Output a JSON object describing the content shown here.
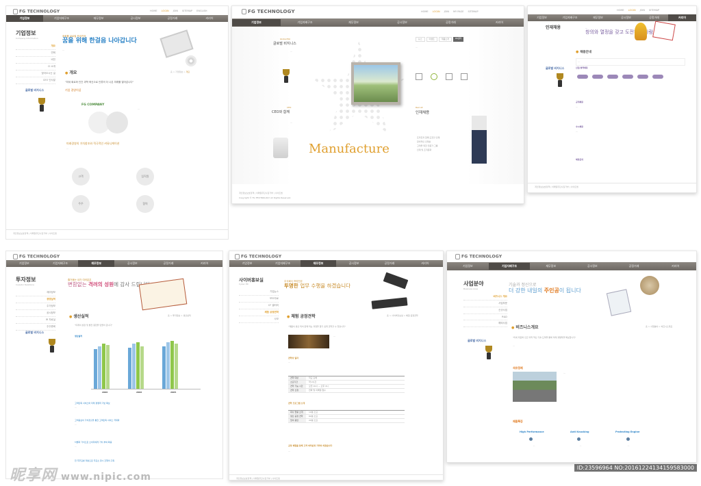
{
  "panels": {
    "p1": {
      "logo": "FG TECHNOLOGY",
      "nav": [
        "기업정보",
        "기업지배구조",
        "재무정보",
        "공시정보",
        "공정거래",
        "커리어"
      ],
      "side_title": "기업정보",
      "side_items": [
        "개요",
        "연혁",
        "비전",
        "CI 소개",
        "찾아오시는 길",
        "CEO 인사말"
      ],
      "hero_small": "조화를 글로벌 프리진의",
      "hero_main": "꿈을 위해 한걸음 나아갑니다",
      "section": "개요",
      "quote": "\"미세 회로와 인간 과학 혁신으로 인류의 더 나은 미래를 열어갑니다\"",
      "highlight": "기업 경영이념",
      "company": "FG COMPANY",
      "circles": [
        "고객",
        "임직원",
        "주주",
        "협력"
      ],
      "section2": "미래경영의 가치창조와 적극적인 커뮤니케이션",
      "badge": "글로벌 비지니스",
      "footer": "개인정보보호정책 | 이메일무단수집거부 | 사이트맵"
    },
    "p2": {
      "logo": "FG TECHNOLOGY",
      "nav": [
        "기업정보",
        "기업지배구조",
        "재무정보",
        "공시정보",
        "공정거래",
        "커리어"
      ],
      "tabs": [
        "뉴스",
        "이벤트",
        "제품소개",
        "PR센터"
      ],
      "side1": "Global Biz",
      "side1_title": "글로벌 비지니스",
      "side2": "CEO",
      "side2_title": "CEO와 함께",
      "brand": "Manufacture",
      "right_title": "인재채용",
      "right_list": [
        "프리진과 함께 도전할 인재",
        "창의적인 인재상",
        "고객을 위한 전문가 그룹",
        "인재 및 조직문화"
      ],
      "footer": "개인정보보호정책 | 이메일무단수집거부 | 사이트맵",
      "copyright": "Copyright © FG TECHNOLOGY All Rights Reserved."
    },
    "p3": {
      "logo": "FG TECHNOLOGY",
      "nav": [
        "기업정보",
        "기업지배구조",
        "재무정보",
        "공시정보",
        "공정거래",
        "커리어"
      ],
      "side_title": "인재채용",
      "hero_main": "창의와 열정을 갖고 도전하는 사람",
      "section": "채용안내",
      "sub1": "신입/경력채용",
      "sub2": "공개채용",
      "sub3": "수시채용",
      "sub4": "채용문의",
      "badge": "글로벌 비지니스",
      "footer": "개인정보보호정책 | 이메일무단수집거부 | 사이트맵"
    },
    "p4": {
      "logo": "FG TECHNOLOGY",
      "nav": [
        "기업정보",
        "기업지배구조",
        "재무정보",
        "공시정보",
        "공정거래",
        "커리어"
      ],
      "side_title": "투자정보",
      "side_items": [
        "재무정보",
        "경영실적",
        "주가정보",
        "공시정보",
        "IR 자료실",
        "주주총회"
      ],
      "hero_small": "즐거움는 내가 여러분은",
      "hero_main1": "변함없는 ",
      "hero_accent": "격려의 성원",
      "hero_main2": "에 감사 드립니다",
      "section": "생산실적",
      "quote": "\"미래의 성장 및 발전 원천을 만들어 갑니다\"",
      "chart_title": "생산실적",
      "years": [
        "2006",
        "2006",
        "2005"
      ],
      "points": [
        "고객만족 서비스와 미래 경쟁력 기반 확보",
        "고객중심의 가치창출을 통한 고객만족 서비스 극대화",
        "차별화 가치으로 소비자에게 가치 부여 확충",
        "전 주주요를 대상으로 주요소 정시 간행의 구축"
      ],
      "badge": "글로벌 비지니스"
    },
    "p5": {
      "logo": "FG TECHNOLOGY",
      "nav": [
        "기업정보",
        "기업지배구조",
        "재무정보",
        "공시정보",
        "공정거래",
        "커리어"
      ],
      "side_title": "사이버홍보실",
      "side_items": [
        "기업뉴스",
        "보도자료",
        "CF 갤러리",
        "체험 공정견학",
        "사보"
      ],
      "hero_small": "주식회사 프리진은",
      "hero_main1": "투명한 ",
      "hero_main2": "업무 수행을 하겠습니다",
      "section": "체험 공정견학",
      "quote": "\"제품이 생산 되어 판매 되는 과정을 알기 쉽게 견학할 수 있습니다\"",
      "sub1": "견학의 일자",
      "rows": [
        [
          "견학 대상",
          "학교 단체"
        ],
        [
          "소요기간",
          "약 2시간"
        ],
        [
          "견학 가능 시간",
          "오전 10시 ~ 오후 4시"
        ],
        [
          "견학 신청",
          "전화 및 이메일 접수"
        ]
      ],
      "sub2": "견학 프로그램 소개",
      "rows2": [
        [
          "회사 현황 소개",
          "10분 소요"
        ],
        [
          "생산 공정 견학",
          "60분 소요"
        ],
        [
          "질의 응답",
          "20분 소요"
        ]
      ],
      "sub3": "공정 체험을 통해 고객 여러분과 가까이 하겠습니다",
      "footer": "개인정보보호정책 | 이메일무단수집거부 | 사이트맵"
    },
    "p6": {
      "logo": "FG TECHNOLOGY",
      "nav": [
        "기업정보",
        "기업지배구조",
        "재무정보",
        "공시정보",
        "공정거래",
        "커리어"
      ],
      "side_title": "사업분야",
      "side_items": [
        "비즈니스 개요",
        "사업부문",
        "신규사업",
        "R&D",
        "해외사업"
      ],
      "hero_small": "기술과 정신으로",
      "hero_main1": "더 강한 내일의 ",
      "hero_accent": "주인공",
      "hero_main2": "이 됩니다",
      "section": "비즈니스개요",
      "quote": "\"미세 회로와 인간 과학 혁신 기술 도약을 통해 미래 경쟁력을 확보합니다\"",
      "sub1": "석유정제",
      "sub2": "제품특징",
      "features": [
        "High Performance",
        "Anti Knocking",
        "Protecting Engine"
      ],
      "badge": "글로벌 비지니스"
    }
  },
  "watermark": {
    "text": "昵享网",
    "url": "www.nipic.com"
  },
  "image_id": "ID:23596964 NO:20161224134159583000"
}
